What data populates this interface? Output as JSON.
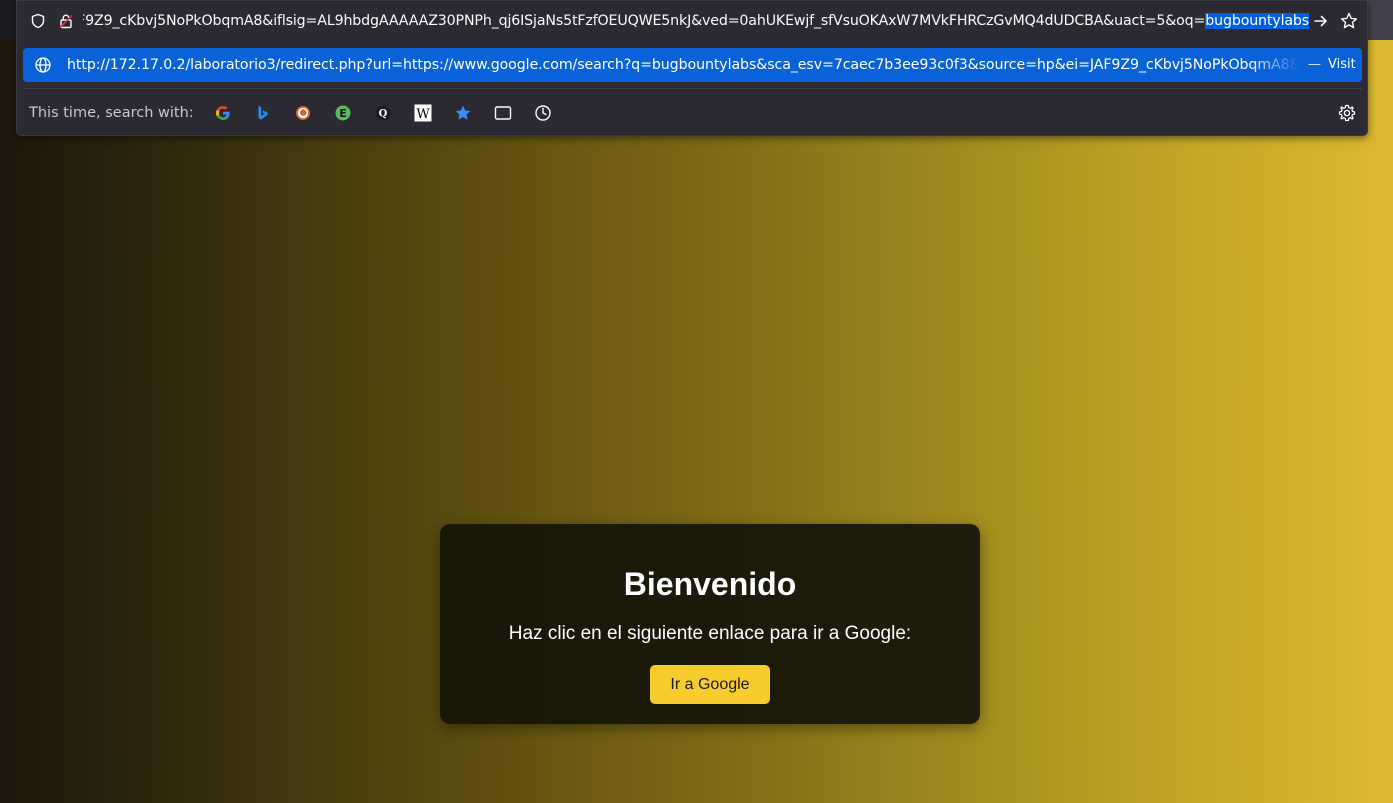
{
  "urlbar": {
    "typed_url_prefix": "http://172.17.0.2/laboratorio3/redirect.php?url=https://www.google.com/search?q=bugbountylabs&sca_esv=7caec7b3ee93c0f3&source=hp&ei=JAF9Z9_cKbvj5NoPkObqmA8&iflsig=AL9hbdgAAAAAZ30PNPh_qj6ISjaNs5tFzfOEUQWE5nkJ&ved=0ahUKEwjf_sfVsuOKAxW7MVkFHRCzGvMQ4dUDCBA&uact=5&oq=",
    "typed_url_selected": "bugbountylabs",
    "suggestion_url": "http://172.17.0.2/laboratorio3/redirect.php?url=https://www.google.com/search?q=bugbountylabs&sca_esv=7caec7b3ee93c0f3&source=hp&ei=JAF9Z9_cKbvj5NoPkObqmA8&iflsig",
    "suggestion_separator": "—",
    "suggestion_action": "Visit",
    "search_with_label": "This time, search with:",
    "engines": [
      "google-icon",
      "bing-icon",
      "duckduckgo-icon",
      "ebay-icon",
      "qwant-icon",
      "wikipedia-icon",
      "bookmarks-icon",
      "tabs-icon",
      "history-icon"
    ]
  },
  "card": {
    "title": "Bienvenido",
    "text": "Haz clic en el siguiente enlace para ir a Google:",
    "button_label": "Ir a Google",
    "button_color": "#f7cd2d"
  },
  "colors": {
    "gradient_left": "#1c170a",
    "gradient_right": "#dcb92f",
    "selection": "#0a62d9"
  }
}
